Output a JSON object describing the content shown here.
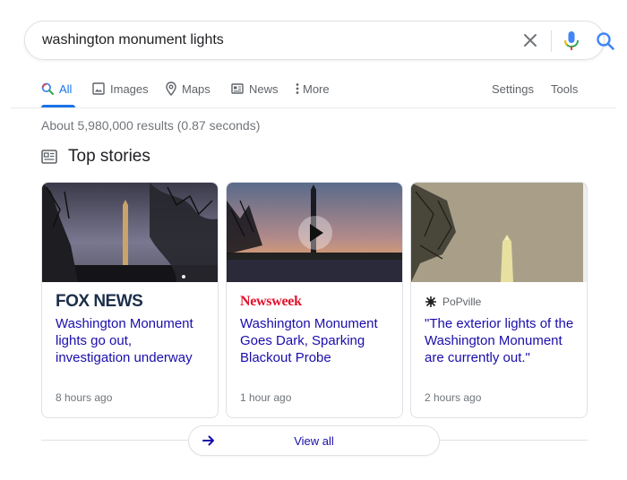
{
  "search": {
    "query": "washington monument lights"
  },
  "tabs": [
    {
      "label": "All",
      "icon": "search-icon",
      "active": true
    },
    {
      "label": "Images",
      "icon": "image-icon"
    },
    {
      "label": "Maps",
      "icon": "map-pin-icon"
    },
    {
      "label": "News",
      "icon": "news-icon"
    },
    {
      "label": "More",
      "icon": "more-vert-icon"
    }
  ],
  "tools": {
    "settings": "Settings",
    "tools": "Tools"
  },
  "result_stats": "About 5,980,000 results (0.87 seconds)",
  "top_stories": {
    "title": "Top stories",
    "cards": [
      {
        "source": "FOX NEWS",
        "headline": "Washington Monument lights go out, investigation underway",
        "time": "8 hours ago"
      },
      {
        "source": "Newsweek",
        "headline": "Washington Monument Goes Dark, Sparking Blackout Probe",
        "time": "1 hour ago",
        "has_video": true
      },
      {
        "source": "PoPville",
        "headline": "\"The exterior lights of the Washington Monument are currently out.\"",
        "time": "2 hours ago"
      }
    ],
    "view_all": "View all"
  },
  "colors": {
    "link": "#1a0dab",
    "accent": "#1a73e8",
    "secondary_text": "#70757a",
    "border": "#dfe1e5",
    "fox_navy": "#1c2f4a",
    "newsweek_red": "#e3122c"
  }
}
